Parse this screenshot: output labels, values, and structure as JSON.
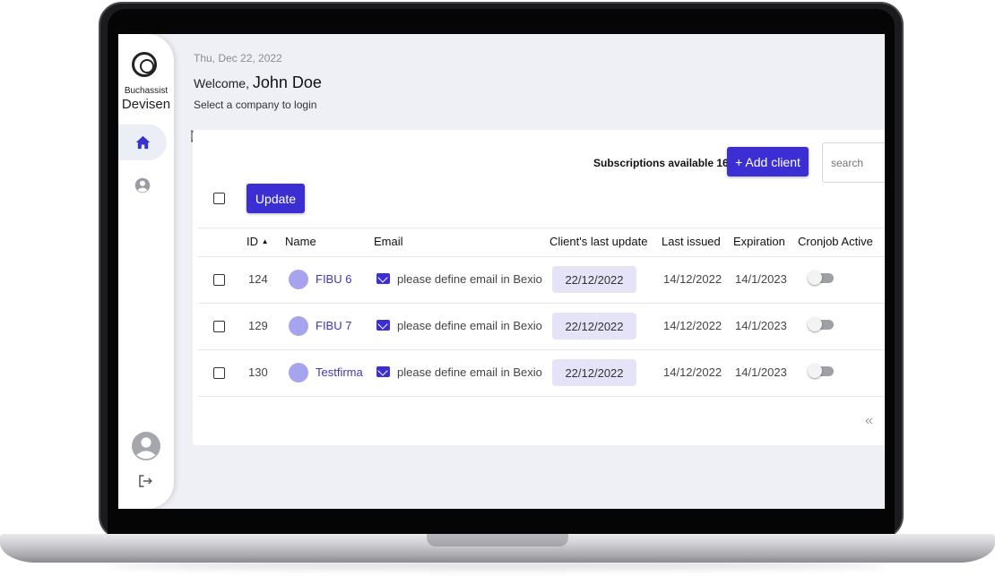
{
  "sidebar": {
    "logo_line1": "Buchassist",
    "logo_line2": "Devisen"
  },
  "header": {
    "date": "Thu, Dec 22, 2022",
    "welcome_prefix": "Welcome,",
    "user_name": "John Doe",
    "subtitle": "Select a company to login"
  },
  "toolbar": {
    "subscriptions": "Subscriptions available 16",
    "add_client_label": "+ Add client",
    "search_placeholder": "search",
    "update_label": "Update"
  },
  "table": {
    "columns": [
      "ID",
      "Name",
      "Email",
      "Client's last update",
      "Last issued",
      "Expiration",
      "Cronjob Active"
    ],
    "sort_indicator": "▲",
    "rows": [
      {
        "id": "124",
        "name": "FIBU 6",
        "email": "please define email in Bexio",
        "last_update": "22/12/2022",
        "last_issued": "14/12/2022",
        "expiration": "14/1/2023",
        "cronjob_active": false
      },
      {
        "id": "129",
        "name": "FIBU 7",
        "email": "please define email in Bexio",
        "last_update": "22/12/2022",
        "last_issued": "14/12/2022",
        "expiration": "14/1/2023",
        "cronjob_active": false
      },
      {
        "id": "130",
        "name": "Testfirma",
        "email": "please define email in Bexio",
        "last_update": "22/12/2022",
        "last_issued": "14/12/2022",
        "expiration": "14/1/2023",
        "cronjob_active": false
      }
    ]
  },
  "pagination": {
    "first_page_glyph": "«"
  },
  "colors": {
    "accent": "#3b2fd4",
    "chip": "#e4e3f7",
    "avatar_dot": "#a7a4ef",
    "background": "#eef0f6"
  },
  "icons": [
    "home-icon",
    "account-circle-icon",
    "user-avatar-icon",
    "logout-icon",
    "mail-icon",
    "sort-ascending-icon",
    "first-page-icon",
    "mouse-cursor-icon"
  ]
}
